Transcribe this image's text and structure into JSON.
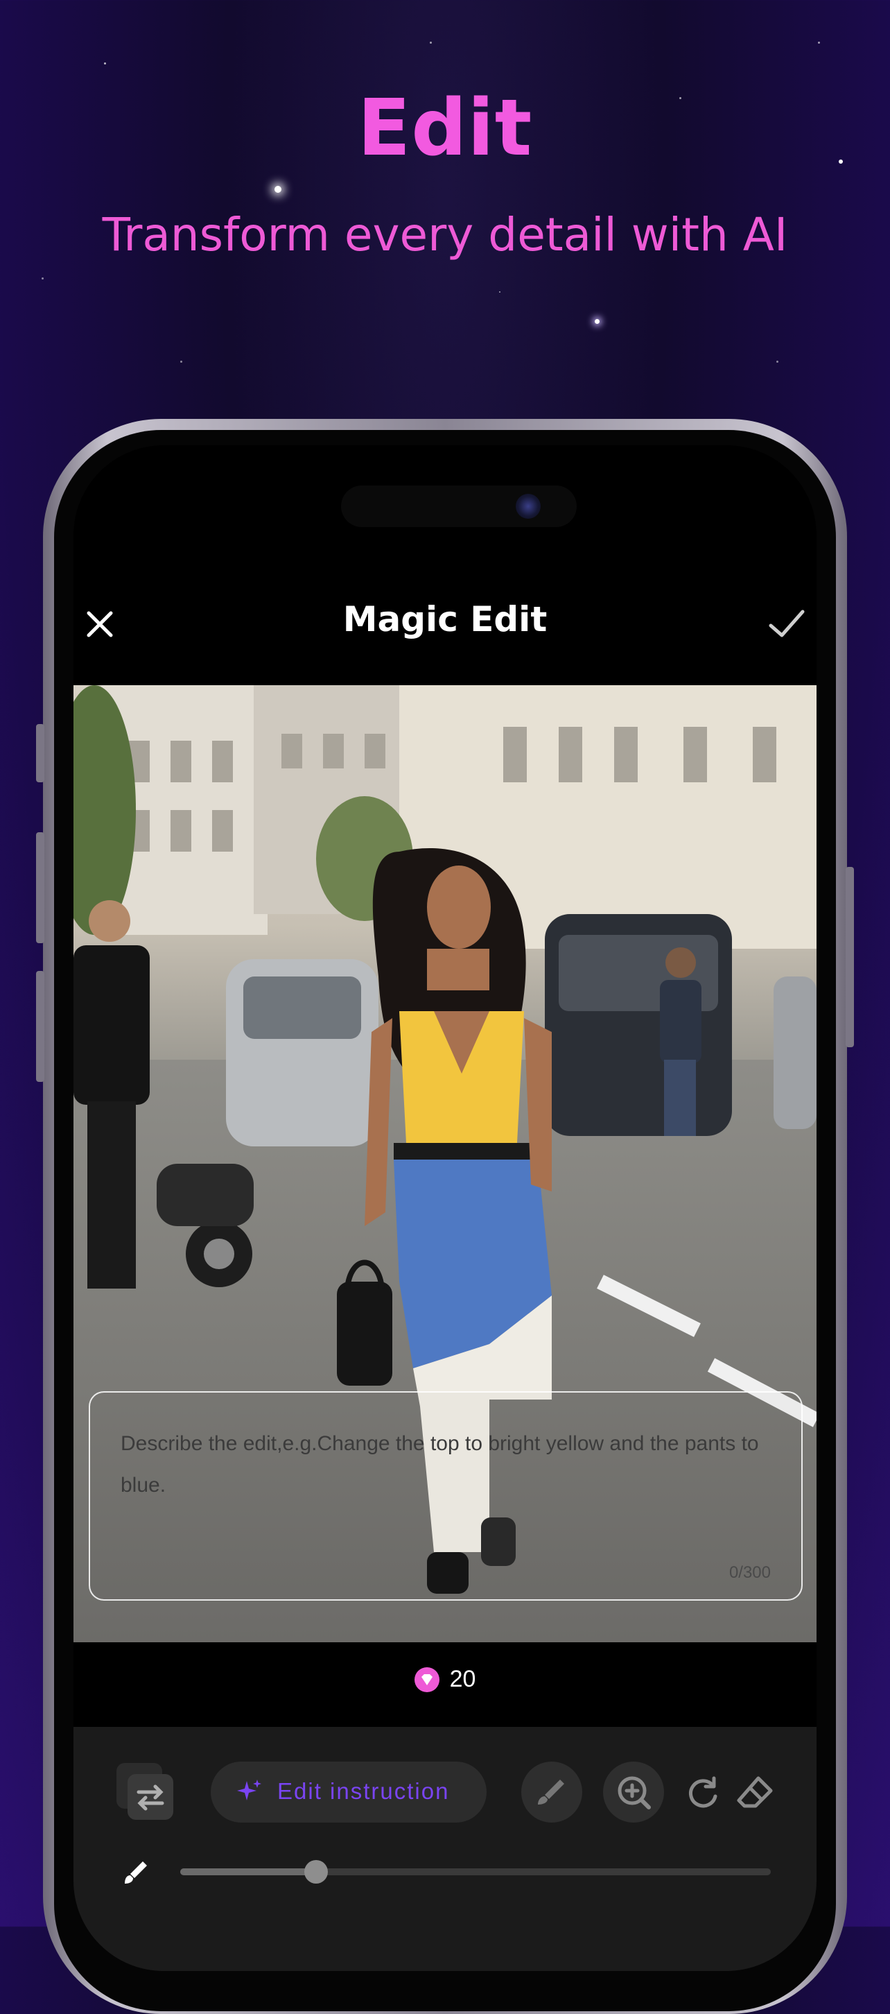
{
  "promo": {
    "title": "Edit",
    "subtitle": "Transform every detail with AI"
  },
  "header": {
    "title": "Magic Edit",
    "close_icon": "close-icon",
    "confirm_icon": "checkmark-icon"
  },
  "prompt": {
    "placeholder": "Describe the edit,e.g.Change the top to bright yellow and the pants to blue.",
    "counter": "0/300"
  },
  "credits": {
    "value": "20",
    "icon": "gem-icon"
  },
  "toolbar": {
    "swap_icon": "swap-icon",
    "edit_instruction_label": "Edit instruction",
    "sparkle_icon": "sparkle-icon",
    "brush_icon": "brush-icon",
    "zoom_icon": "zoom-in-icon",
    "redo_icon": "rotate-icon",
    "eraser_icon": "eraser-icon"
  },
  "brush_size": {
    "icon": "brush-icon",
    "level": 0.23
  },
  "colors": {
    "accent_pink": "#f25ae0",
    "accent_purple": "#7a44f2",
    "toolbar_bg": "#1b1b1b"
  }
}
